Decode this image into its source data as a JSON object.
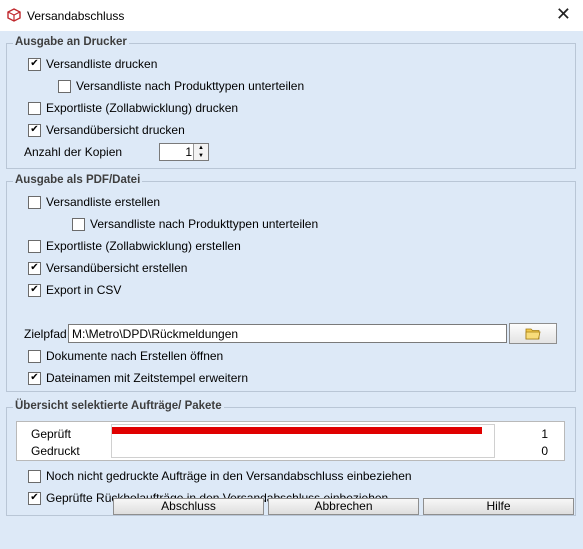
{
  "window": {
    "title": "Versandabschluss"
  },
  "printer_group": {
    "title": "Ausgabe an Drucker",
    "items": [
      {
        "label": "Versandliste drucken",
        "checked": true
      },
      {
        "label": "Versandliste nach Produkttypen unterteilen",
        "checked": false
      },
      {
        "label": "Exportliste (Zollabwicklung) drucken",
        "checked": false
      },
      {
        "label": "Versandübersicht drucken",
        "checked": true
      }
    ],
    "copies_label": "Anzahl der Kopien",
    "copies_value": "1"
  },
  "pdf_group": {
    "title": "Ausgabe als PDF/Datei",
    "items": [
      {
        "label": "Versandliste erstellen",
        "checked": false
      },
      {
        "label": "Versandliste nach Produkttypen unterteilen",
        "checked": false
      },
      {
        "label": "Exportliste (Zollabwicklung) erstellen",
        "checked": false
      },
      {
        "label": "Versandübersicht erstellen",
        "checked": true
      },
      {
        "label": "Export in CSV",
        "checked": true
      }
    ],
    "path_label": "Zielpfad",
    "path_value": "M:\\Metro\\DPD\\Rückmeldungen",
    "extra": [
      {
        "label": "Dokumente nach Erstellen öffnen",
        "checked": false
      },
      {
        "label": "Dateinamen mit Zeitstempel erweitern",
        "checked": true
      }
    ]
  },
  "orders_group": {
    "title": "Übersicht selektierte Aufträge/ Pakete",
    "rows": [
      {
        "label": "Geprüft",
        "value": "1",
        "fraction": 1.0
      },
      {
        "label": "Gedruckt",
        "value": "0",
        "fraction": 0.0
      }
    ],
    "items": [
      {
        "label": "Noch nicht gedruckte Aufträge in den Versandabschluss einbeziehen",
        "checked": false
      },
      {
        "label": "Geprüfte Rückholaufträge in den Versandabschluss einbeziehen",
        "checked": true
      }
    ]
  },
  "buttons": {
    "finish": "Abschluss",
    "cancel": "Abbrechen",
    "help": "Hilfe"
  },
  "check_glyph": "✔"
}
